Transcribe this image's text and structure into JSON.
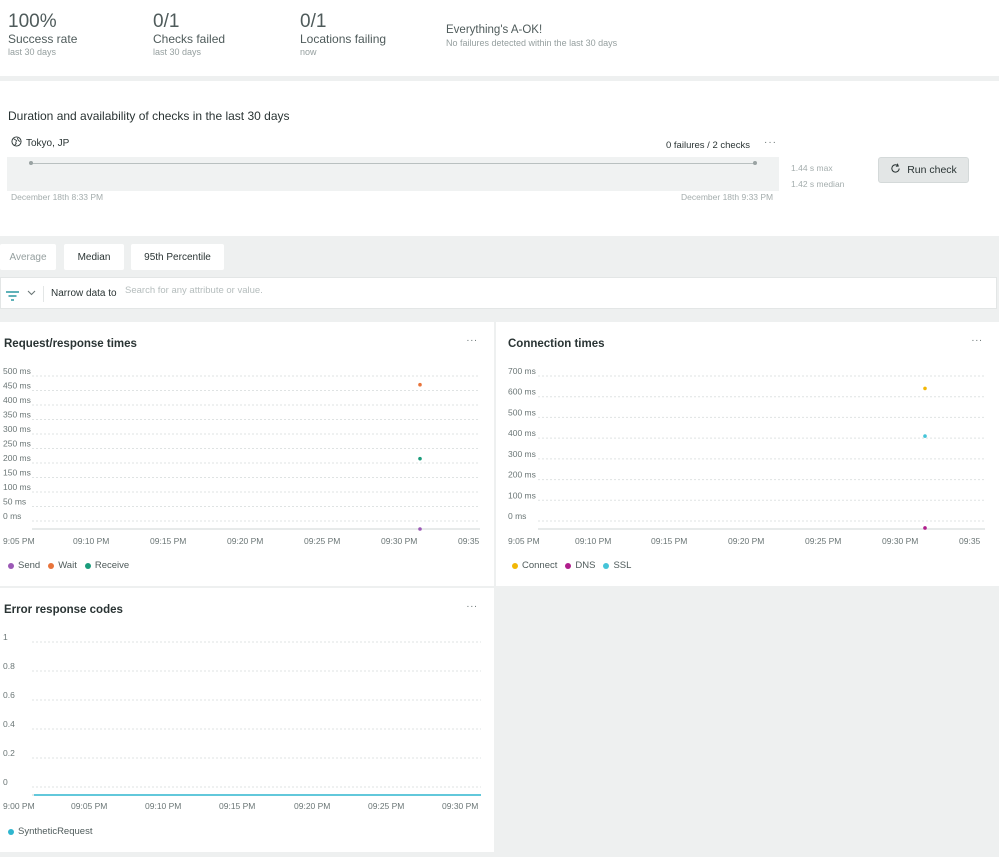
{
  "summary": {
    "success": {
      "value": "100%",
      "label": "Success rate",
      "sub": "last 30 days"
    },
    "checks": {
      "value": "0/1",
      "label": "Checks failed",
      "sub": "last 30 days"
    },
    "locations": {
      "value": "0/1",
      "label": "Locations failing",
      "sub": "now"
    },
    "status": {
      "title": "Everything's A-OK!",
      "sub": "No failures detected within the last 30 days"
    }
  },
  "duration": {
    "title": "Duration and availability of checks in the last 30 days",
    "location": "Tokyo, JP",
    "failures": "0 failures / 2 checks",
    "more": "···",
    "start_date": "December 18th 8:33 PM",
    "end_date": "December 18th 9:33 PM",
    "max": "1.44 s max",
    "median": "1.42 s median",
    "run_label": "Run check"
  },
  "tabs": [
    {
      "label": "Average",
      "active": false
    },
    {
      "label": "Median",
      "active": true
    },
    {
      "label": "95th Percentile",
      "active": true
    }
  ],
  "filter": {
    "narrow_label": "Narrow data to",
    "placeholder": "Search for any attribute or value."
  },
  "colors": {
    "send": "#9b59b6",
    "wait": "#e8743b",
    "receive": "#1a9c7b",
    "connect": "#f2b705",
    "dns": "#b01e8c",
    "ssl": "#45c4d8",
    "synthetic": "#2fb6cf",
    "accent": "#00838f"
  },
  "chart_data": [
    {
      "id": "request-response",
      "type": "scatter",
      "title": "Request/response times",
      "x_ticks": [
        "9:05 PM",
        "09:10 PM",
        "09:15 PM",
        "09:20 PM",
        "09:25 PM",
        "09:30 PM",
        "09:35"
      ],
      "y_ticks": [
        "0 ms",
        "50 ms",
        "100 ms",
        "150 ms",
        "200 ms",
        "250 ms",
        "300 ms",
        "350 ms",
        "400 ms",
        "450 ms",
        "500 ms"
      ],
      "ylim": [
        0,
        500
      ],
      "series": [
        {
          "name": "Send",
          "color_key": "send",
          "points": [
            {
              "x": "09:31 PM",
              "y": 0
            }
          ]
        },
        {
          "name": "Wait",
          "color_key": "wait",
          "points": [
            {
              "x": "09:31 PM",
              "y": 470
            }
          ]
        },
        {
          "name": "Receive",
          "color_key": "receive",
          "points": [
            {
              "x": "09:31 PM",
              "y": 215
            }
          ]
        }
      ]
    },
    {
      "id": "connection",
      "type": "scatter",
      "title": "Connection times",
      "x_ticks": [
        "9:05 PM",
        "09:10 PM",
        "09:15 PM",
        "09:20 PM",
        "09:25 PM",
        "09:30 PM",
        "09:35"
      ],
      "y_ticks": [
        "0 ms",
        "100 ms",
        "200 ms",
        "300 ms",
        "400 ms",
        "500 ms",
        "600 ms",
        "700 ms"
      ],
      "ylim": [
        0,
        700
      ],
      "series": [
        {
          "name": "Connect",
          "color_key": "connect",
          "points": [
            {
              "x": "09:31 PM",
              "y": 640
            }
          ]
        },
        {
          "name": "DNS",
          "color_key": "dns",
          "points": [
            {
              "x": "09:31 PM",
              "y": 5
            }
          ]
        },
        {
          "name": "SSL",
          "color_key": "ssl",
          "points": [
            {
              "x": "09:31 PM",
              "y": 410
            }
          ]
        }
      ]
    },
    {
      "id": "error-codes",
      "type": "line",
      "title": "Error response codes",
      "x_ticks": [
        "9:00 PM",
        "09:05 PM",
        "09:10 PM",
        "09:15 PM",
        "09:20 PM",
        "09:25 PM",
        "09:30 PM"
      ],
      "y_ticks": [
        "0",
        "0.2",
        "0.4",
        "0.6",
        "0.8",
        "1"
      ],
      "ylim": [
        0,
        1
      ],
      "series": [
        {
          "name": "SyntheticRequest",
          "color_key": "synthetic",
          "values": [
            0,
            0,
            0,
            0,
            0,
            0,
            0
          ]
        }
      ]
    }
  ]
}
